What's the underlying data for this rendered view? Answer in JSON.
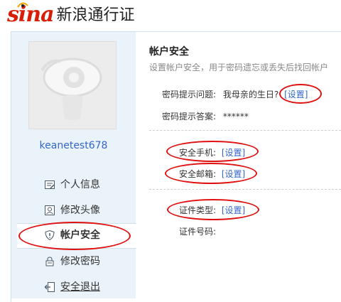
{
  "header": {
    "logo_text": "sina",
    "product": "新浪通行证"
  },
  "user": {
    "name": "keanetest678"
  },
  "sidebar": {
    "items": [
      {
        "label": "个人信息",
        "icon": "profile-icon"
      },
      {
        "label": "修改头像",
        "icon": "portrait-icon"
      },
      {
        "label": "帐户安全",
        "icon": "shield-icon",
        "active": true
      },
      {
        "label": "修改密码",
        "icon": "lock-icon"
      },
      {
        "label": "安全退出",
        "icon": "logout-icon"
      }
    ]
  },
  "main": {
    "title": "帐户安全",
    "subtitle": "设置帐户安全，用于密码遗忘或丢失后找回帐户",
    "security_question_label": "密码提示问题:",
    "security_question_value": "我母亲的生日?",
    "security_answer_label": "密码提示答案:",
    "security_answer_value": "******",
    "phone_label": "安全手机:",
    "email_label": "安全邮箱:",
    "id_type_label": "证件类型:",
    "id_number_label": "证件号码:",
    "set_link": "[设置]"
  },
  "colors": {
    "brand": "#d81e06",
    "link": "#3366cc",
    "sidebar_bg": "#eaf3fa",
    "annotation": "#e01010"
  }
}
